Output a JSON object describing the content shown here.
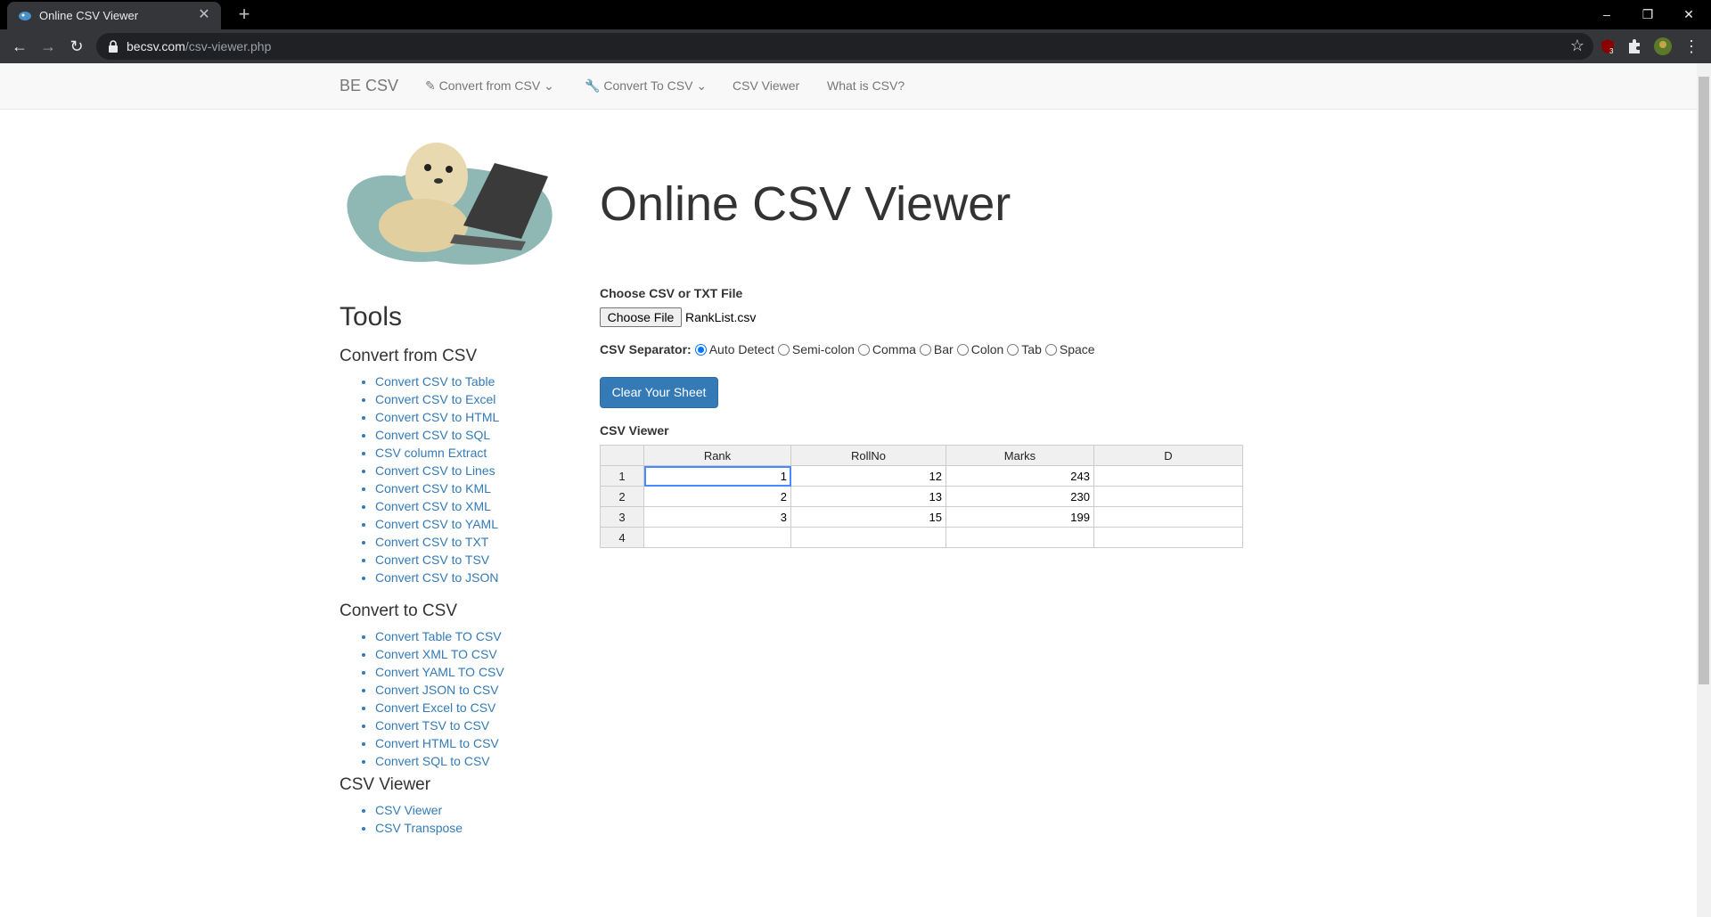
{
  "browser": {
    "tab_title": "Online CSV Viewer",
    "new_tab": "+",
    "url_host": "becsv.com",
    "url_path": "/csv-viewer.php",
    "window_controls": [
      "–",
      "❐",
      "✕"
    ],
    "badge_count": "3"
  },
  "navbar": {
    "brand": "BE CSV",
    "items": [
      {
        "label": "Convert from CSV",
        "icon": "pencil-icon"
      },
      {
        "label": "Convert To CSV",
        "icon": "wrench-icon"
      },
      {
        "label": "CSV Viewer"
      },
      {
        "label": "What is CSV?"
      }
    ]
  },
  "main": {
    "heading": "Online CSV Viewer",
    "file_label": "Choose CSV or TXT File",
    "file_button": "Choose File",
    "file_name": "RankList.csv",
    "separator_label": "CSV Separator:",
    "separator_options": [
      "Auto Detect",
      "Semi-colon",
      "Comma",
      "Bar",
      "Colon",
      "Tab",
      "Space"
    ],
    "separator_selected": "Auto Detect",
    "clear_button": "Clear Your Sheet",
    "viewer_label": "CSV Viewer"
  },
  "sheet": {
    "columns": [
      "Rank",
      "RollNo",
      "Marks",
      "D"
    ],
    "rows": [
      {
        "n": "1",
        "cells": [
          "1",
          "12",
          "243",
          ""
        ]
      },
      {
        "n": "2",
        "cells": [
          "2",
          "13",
          "230",
          ""
        ]
      },
      {
        "n": "3",
        "cells": [
          "3",
          "15",
          "199",
          ""
        ]
      },
      {
        "n": "4",
        "cells": [
          "",
          "",
          "",
          ""
        ]
      }
    ]
  },
  "sidebar": {
    "title": "Tools",
    "groups": [
      {
        "title": "Convert from CSV",
        "links": [
          "Convert CSV to Table",
          "Convert CSV to Excel",
          "Convert CSV to HTML",
          "Convert CSV to SQL",
          "CSV column Extract",
          "Convert CSV to Lines",
          "Convert CSV to KML",
          "Convert CSV to XML",
          "Convert CSV to YAML",
          "Convert CSV to TXT",
          "Convert CSV to TSV",
          "Convert CSV to JSON"
        ]
      },
      {
        "title": "Convert to CSV",
        "links": [
          "Convert Table TO CSV",
          "Convert XML TO CSV",
          "Convert YAML TO CSV",
          "Convert JSON to CSV",
          "Convert Excel to CSV",
          "Convert TSV to CSV",
          "Convert HTML to CSV",
          "Convert SQL to CSV"
        ]
      },
      {
        "title": "CSV Viewer",
        "links": [
          "CSV Viewer",
          "CSV Transpose"
        ]
      }
    ]
  }
}
